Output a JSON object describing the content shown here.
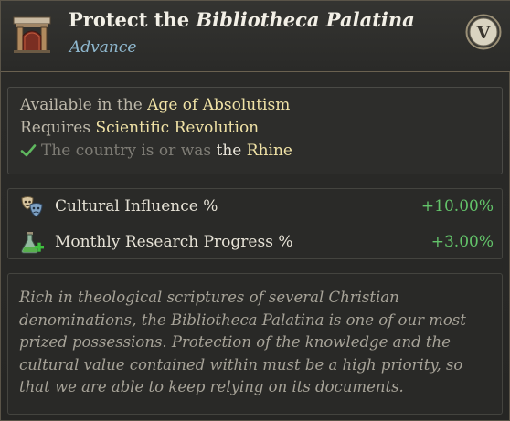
{
  "header": {
    "title_prefix": "Protect the ",
    "title_emphasis": "Bibliotheca Palatina",
    "subtitle": "Advance",
    "badge_label": "V",
    "icon": "gate-icon"
  },
  "requirements": {
    "age_prefix": "Available in the ",
    "age_value": "Age of Absolutism",
    "requires_prefix": "Requires ",
    "requires_value": "Scientific Revolution",
    "condition_text": "The country is or was ",
    "condition_the": "the ",
    "condition_value": "Rhine",
    "check_icon": "checkmark-icon"
  },
  "modifiers": [
    {
      "label": "Cultural Influence %",
      "value": "+10.00%",
      "icon": "masks-icon"
    },
    {
      "label": "Monthly Research Progress %",
      "value": "+3.00%",
      "icon": "flask-plus-icon"
    }
  ],
  "description": "Rich in theological scriptures of several Christian denominations, the Bibliotheca Palatina is one of our most prized possessions. Protection of the knowledge and the cultural value contained within must be a high priority, so that we are able to keep relying on its documents.",
  "colors": {
    "highlight": "#f0e2a6",
    "positive": "#63c46a",
    "subtitle": "#8fb8cf"
  }
}
